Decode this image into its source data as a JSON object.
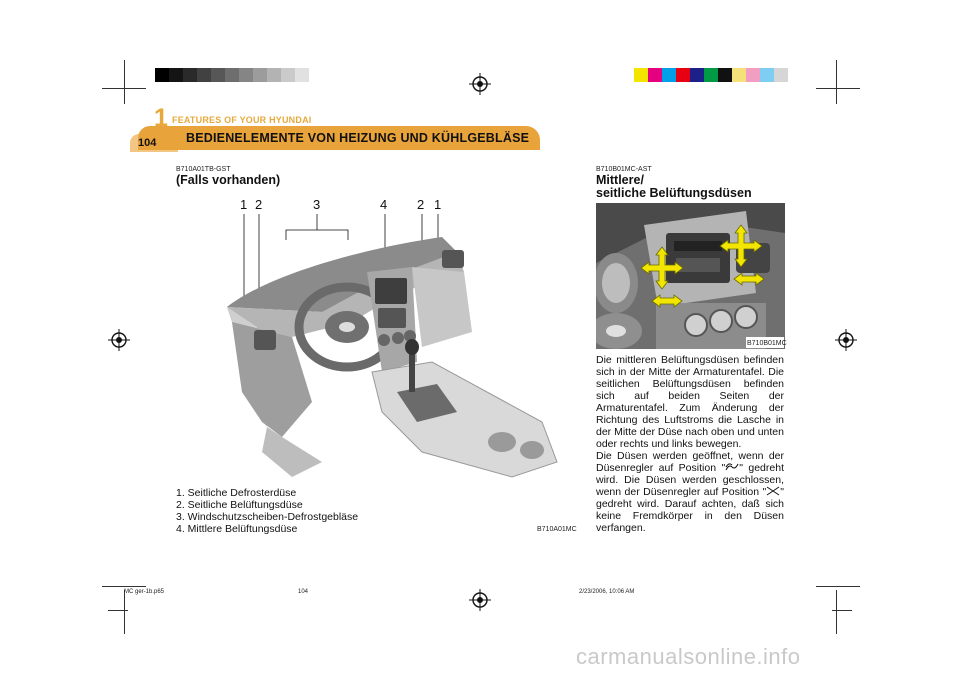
{
  "header": {
    "chapter_number": "1",
    "chapter_title": "FEATURES OF YOUR HYUNDAI",
    "page_number": "104",
    "section_title": "BEDIENELEMENTE VON HEIZUNG UND KÜHLGEBLÄSE"
  },
  "left": {
    "code": "B710A01TB-GST",
    "subtitle": "(Falls vorhanden)",
    "callouts": [
      "1",
      "2",
      "3",
      "4",
      "2",
      "1"
    ],
    "image_code": "B710A01MC",
    "items": [
      "1. Seitliche Defrosterdüse",
      "2. Seitliche Belüftungsdüse",
      "3. Windschutzscheiben-Defrostgebläse",
      "4. Mittlere Belüftungsdüse"
    ]
  },
  "right": {
    "code": "B710B01MC-AST",
    "title_line1": "Mittlere/",
    "title_line2": "seitliche Belüftungsdüsen",
    "image_code": "B710B01MC",
    "paragraph1": "Die mittleren Belüftungsdüsen befinden sich in der Mitte der Armaturentafel. Die seitlichen Belüftungsdüsen befinden sich auf beiden Seiten der Armaturentafel. Zum Änderung der Richtung des Luftstroms die Lasche in der Mitte der Düse nach oben und unten oder rechts und links bewegen.",
    "p2_part1": "Die Düsen werden geöffnet, wenn der Düsenregler auf Position \"",
    "p2_part2": "\" gedreht wird. Die Düsen werden geschlossen, wenn der Düsenregler auf Position \"",
    "p2_part3": "\" gedreht wird. Darauf achten, daß sich keine Fremdkörper in den Düsen verfangen."
  },
  "footer": {
    "file": "MC ger-1b.p65",
    "page": "104",
    "timestamp": "2/23/2006, 10:06 AM"
  },
  "watermark": "carmanualsonline.info",
  "colors": {
    "accent": "#e8a33a",
    "accent_light": "#f3c783",
    "arrow_yellow": "#f2e600"
  }
}
